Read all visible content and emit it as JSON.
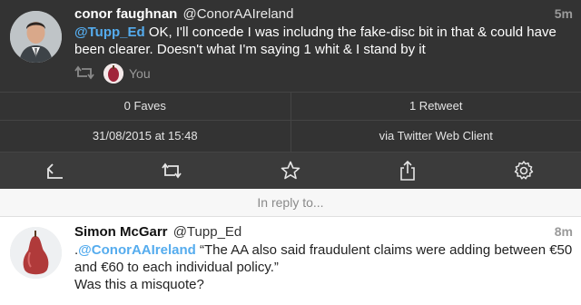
{
  "main_tweet": {
    "display_name": "conor faughnan",
    "handle": "@ConorAAIreland",
    "time": "5m",
    "mention": "@Tupp_Ed",
    "text": " OK, I'll concede I was includng the fake-disc bit in that & could have been clearer. Doesn't what I'm saying 1 whit & I stand by it",
    "retweeted_by": "You"
  },
  "stats": {
    "faves": "0 Faves",
    "retweets": "1 Retweet"
  },
  "meta": {
    "date": "31/08/2015 at 15:48",
    "via": "via Twitter Web Client"
  },
  "actions": {
    "reply_icon": "reply-icon",
    "retweet_icon": "retweet-icon",
    "favorite_icon": "star-icon",
    "share_icon": "share-icon",
    "settings_icon": "gear-icon"
  },
  "reply_header": "In reply to...",
  "reply_tweet": {
    "display_name": "Simon McGarr",
    "handle": "@Tupp_Ed",
    "time": "8m",
    "prefix": ".",
    "mention": "@ConorAAIreland",
    "text": " “The AA also said fraudulent claims were adding between €50 and €60 to each individual policy.”",
    "text2": "Was this a misquote?"
  },
  "colors": {
    "dark_bg": "#333333",
    "link_blue": "#55acee",
    "muted": "#9a9a9a"
  }
}
